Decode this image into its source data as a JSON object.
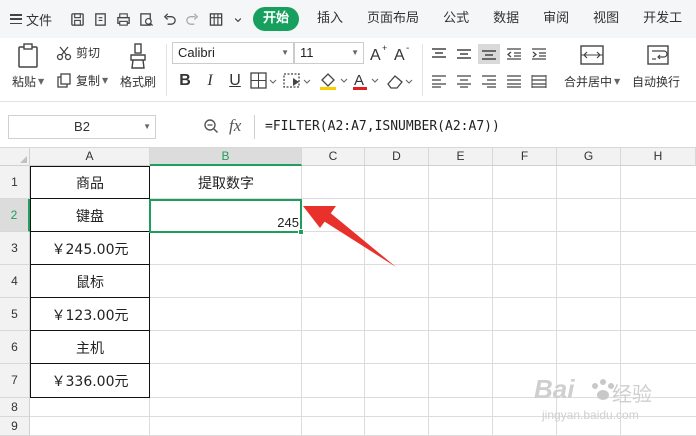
{
  "menubar": {
    "file_label": "文件",
    "tabs": [
      {
        "label": "开始",
        "active": true
      },
      {
        "label": "插入"
      },
      {
        "label": "页面布局"
      },
      {
        "label": "公式"
      },
      {
        "label": "数据"
      },
      {
        "label": "审阅"
      },
      {
        "label": "视图"
      },
      {
        "label": "开发工"
      }
    ]
  },
  "ribbon": {
    "cut": "剪切",
    "paste": "粘贴",
    "copy": "复制",
    "format_painter": "格式刷",
    "font_name": "Calibri",
    "font_size": "11",
    "merge_center": "合并居中",
    "wrap_text": "自动换行"
  },
  "formula_bar": {
    "name_box": "B2",
    "fx": "fx",
    "formula": "=FILTER(A2:A7,ISNUMBER(A2:A7))"
  },
  "sheet": {
    "columns": [
      "A",
      "B",
      "C",
      "D",
      "E",
      "F",
      "G",
      "H"
    ],
    "rows": [
      "1",
      "2",
      "3",
      "4",
      "5",
      "6",
      "7",
      "8",
      "9"
    ],
    "cells": {
      "A1": "商品",
      "B1": "提取数字",
      "A2": "键盘",
      "B2": "245",
      "A3": "￥245.00元",
      "A4": "鼠标",
      "A5": "￥123.00元",
      "A6": "主机",
      "A7": "￥336.00元"
    },
    "selected_cell": "B2"
  },
  "colors": {
    "accent": "#17a05d",
    "arrow": "#e8312b"
  },
  "watermark": {
    "brand": "Bai",
    "brand_tail": "经验",
    "url": "jingyan.baidu.com"
  }
}
